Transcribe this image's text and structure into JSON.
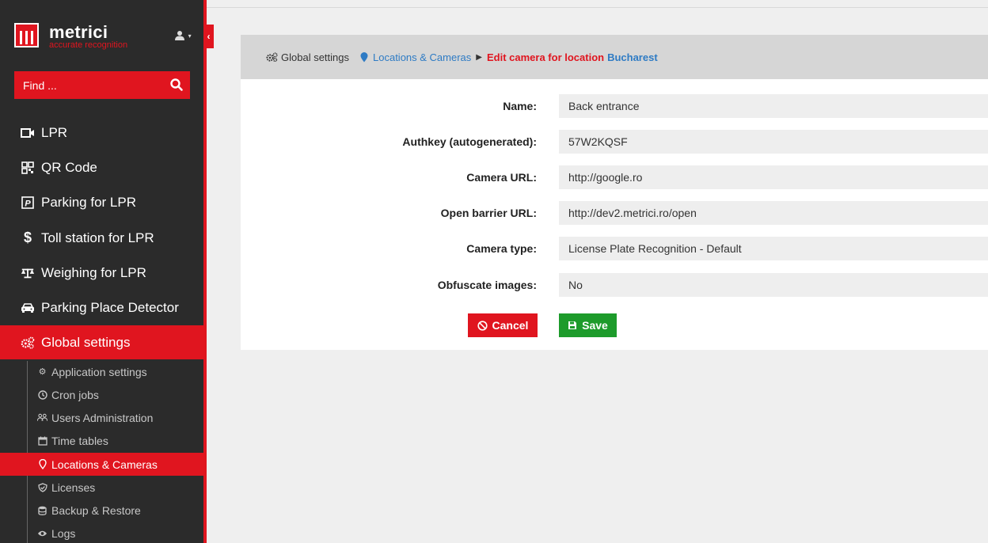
{
  "brand": {
    "name": "metrici",
    "tagline": "accurate recognition"
  },
  "colors": {
    "accent": "#e0151f",
    "sidebar_bg": "#2b2b2b",
    "link": "#2e7bc4",
    "save": "#1d9b2b"
  },
  "search": {
    "placeholder": "Find ..."
  },
  "nav": [
    {
      "label": "LPR",
      "icon": "video-camera-icon"
    },
    {
      "label": "QR Code",
      "icon": "qrcode-icon"
    },
    {
      "label": "Parking for LPR",
      "icon": "parking-icon"
    },
    {
      "label": "Toll station for LPR",
      "icon": "dollar-icon"
    },
    {
      "label": "Weighing for LPR",
      "icon": "balance-scale-icon"
    },
    {
      "label": "Parking Place Detector",
      "icon": "car-icon"
    },
    {
      "label": "Global settings",
      "icon": "cogs-icon",
      "active": true
    }
  ],
  "subnav": [
    {
      "label": "Application settings",
      "icon": "gear-icon"
    },
    {
      "label": "Cron jobs",
      "icon": "clock-icon"
    },
    {
      "label": "Users Administration",
      "icon": "users-icon"
    },
    {
      "label": "Time tables",
      "icon": "calendar-icon"
    },
    {
      "label": "Locations & Cameras",
      "icon": "map-marker-icon",
      "active": true
    },
    {
      "label": "Licenses",
      "icon": "shield-check-icon"
    },
    {
      "label": "Backup & Restore",
      "icon": "database-icon"
    },
    {
      "label": "Logs",
      "icon": "eye-icon"
    }
  ],
  "breadcrumb": {
    "root": "Global settings",
    "section": "Locations & Cameras",
    "current": "Edit camera for location",
    "location": "Bucharest"
  },
  "form": {
    "fields": [
      {
        "label": "Name:",
        "value": "Back entrance"
      },
      {
        "label": "Authkey (autogenerated):",
        "value": "57W2KQSF"
      },
      {
        "label": "Camera URL:",
        "value": "http://google.ro"
      },
      {
        "label": "Open barrier URL:",
        "value": "http://dev2.metrici.ro/open"
      },
      {
        "label": "Camera type:",
        "value": "License Plate Recognition - Default"
      },
      {
        "label": "Obfuscate images:",
        "value": "No"
      }
    ],
    "cancel_label": "Cancel",
    "save_label": "Save"
  }
}
